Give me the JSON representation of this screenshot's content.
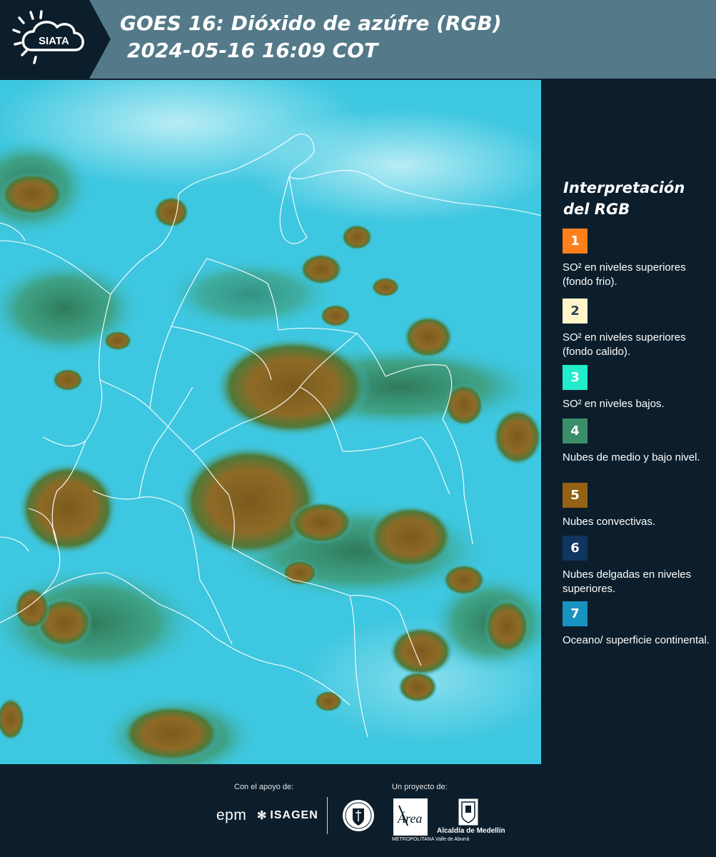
{
  "header": {
    "logo_text": "SIATA",
    "title_line1": "GOES 16: Dióxido de azúfre (RGB)",
    "title_line2": "2024-05-16 16:09 COT",
    "background_color": "#547a89"
  },
  "legend": {
    "title_line1": "Interpretación",
    "title_line2": "del RGB",
    "items": [
      {
        "number": "1",
        "color": "#ff7f1a",
        "text": "SO² en niveles superiores (fondo frio)."
      },
      {
        "number": "2",
        "color": "#fff5c8",
        "text": "SO² en niveles superiores (fondo calido)."
      },
      {
        "number": "3",
        "color": "#22eccc",
        "text": "SO² en niveles bajos."
      },
      {
        "number": "4",
        "color": "#3a8f6a",
        "text": "Nubes de medio y bajo nivel."
      },
      {
        "number": "5",
        "color": "#936214",
        "text": "Nubes convectivas."
      },
      {
        "number": "6",
        "color": "#0f3560",
        "text": "Nubes delgadas en niveles superiores."
      },
      {
        "number": "7",
        "color": "#1892bf",
        "text": "Oceano/ superficie continental."
      }
    ]
  },
  "footer": {
    "support_label": "Con el apoyo de:",
    "project_label": "Un proyecto de:",
    "epm_text": "epm",
    "isagen_text": "ISAGEN",
    "area_brand": "Área",
    "area_subtitle": "METROPOLITANA Valle de Aburrá",
    "alcaldia_text": "Alcaldía de Medellín"
  },
  "colors": {
    "ocean": "#3ec7e0",
    "cloud_convective": "#8c6a24",
    "cloud_low": "#3a8a5a",
    "border": "#ffffff"
  }
}
